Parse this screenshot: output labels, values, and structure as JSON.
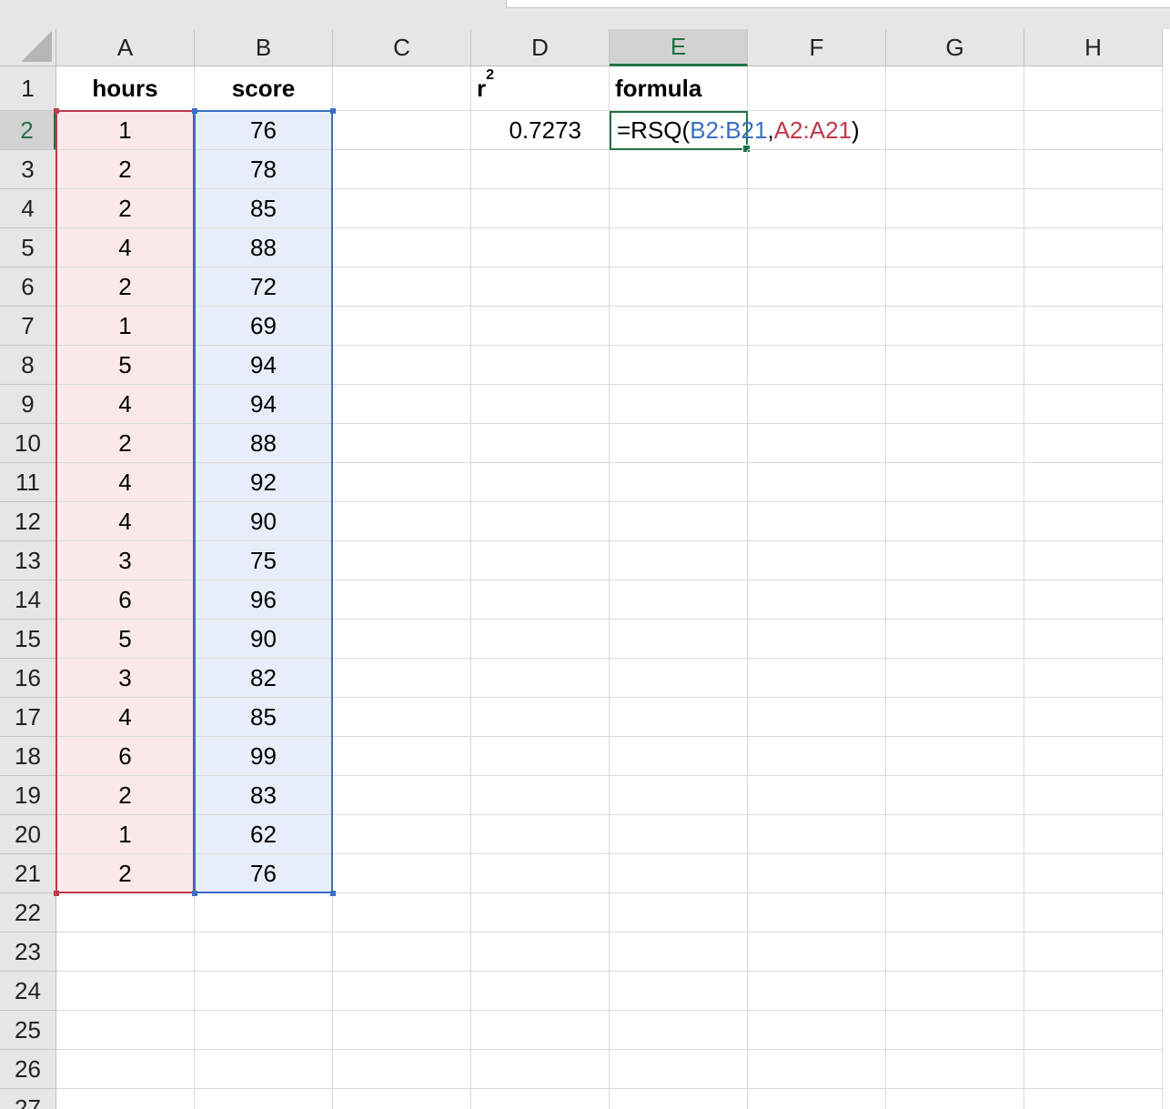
{
  "columns": [
    "A",
    "B",
    "C",
    "D",
    "E",
    "F",
    "G",
    "H"
  ],
  "selected_column": "E",
  "rows": [
    "1",
    "2",
    "3",
    "4",
    "5",
    "6",
    "7",
    "8",
    "9",
    "10",
    "11",
    "12",
    "13",
    "14",
    "15",
    "16",
    "17",
    "18",
    "19",
    "20",
    "21",
    "22",
    "23",
    "24",
    "25",
    "26",
    "27"
  ],
  "selected_row": "2",
  "headers": {
    "hours": "hours",
    "score": "score",
    "r2_base": "r",
    "r2_sup": "2",
    "formula": "formula"
  },
  "hours": [
    "1",
    "2",
    "2",
    "4",
    "2",
    "1",
    "5",
    "4",
    "2",
    "4",
    "4",
    "3",
    "6",
    "5",
    "3",
    "4",
    "6",
    "2",
    "1",
    "2"
  ],
  "scores": [
    "76",
    "78",
    "85",
    "88",
    "72",
    "69",
    "94",
    "94",
    "88",
    "92",
    "90",
    "75",
    "96",
    "90",
    "82",
    "85",
    "99",
    "83",
    "62",
    "76"
  ],
  "r2_value": "0.7273",
  "formula_edit": {
    "prefix": "=RSQ(",
    "ref1": "B2:B21",
    "sep": ", ",
    "ref2": "A2:A21",
    "suffix": ")"
  },
  "colors": {
    "accent": "#217346",
    "ref_blue": "#3a6fc4",
    "ref_red": "#c0394b",
    "fill_pink": "#fbe9ea",
    "fill_blue": "#e8eef9"
  }
}
